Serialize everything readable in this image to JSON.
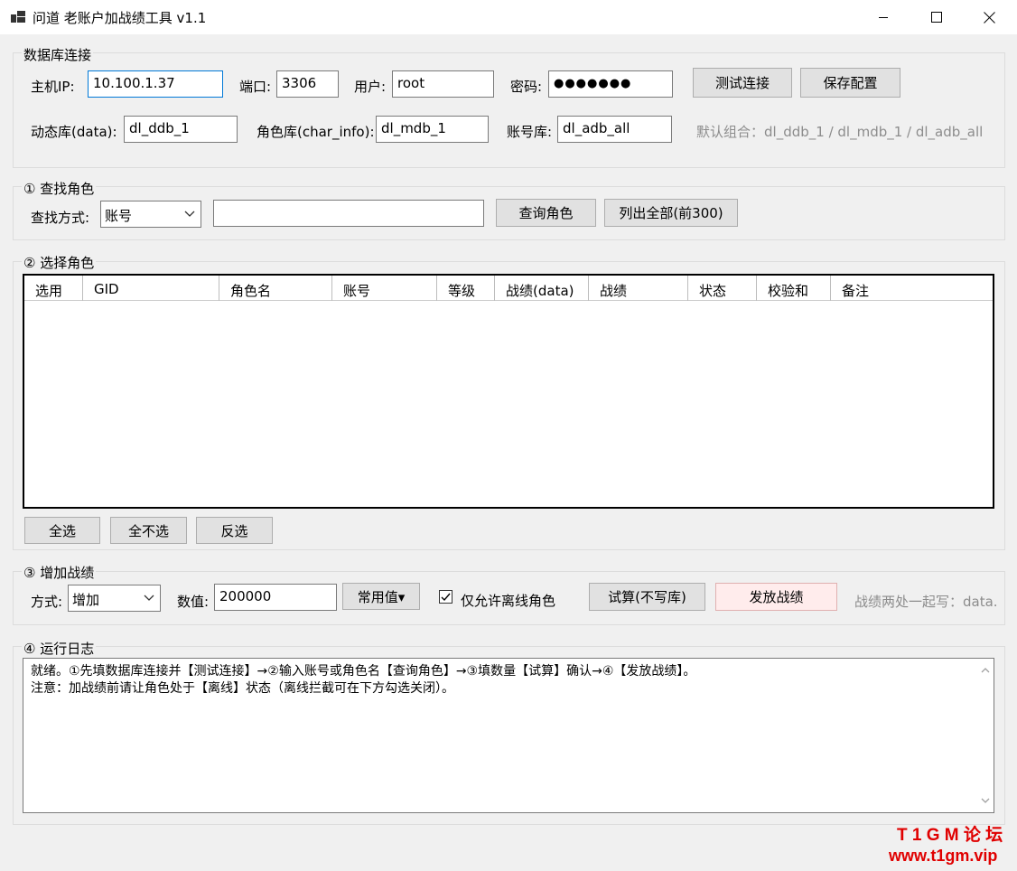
{
  "window": {
    "title": "问道 老账户加战绩工具  v1.1",
    "minimize_icon": "minimize-icon",
    "maximize_icon": "maximize-icon",
    "close_icon": "close-icon"
  },
  "db": {
    "group_title": "数据库连接",
    "host_label": "主机IP:",
    "host_value": "10.100.1.37",
    "port_label": "端口:",
    "port_value": "3306",
    "user_label": "用户:",
    "user_value": "root",
    "password_label": "密码:",
    "password_value": "●●●●●●●",
    "test_button": "测试连接",
    "save_button": "保存配置",
    "data_label": "动态库(data):",
    "data_value": "dl_ddb_1",
    "char_label": "角色库(char_info):",
    "char_value": "dl_mdb_1",
    "account_label": "账号库:",
    "account_value": "dl_adb_all",
    "default_hint": "默认组合：dl_ddb_1 / dl_mdb_1 / dl_adb_all"
  },
  "find": {
    "group_title": "① 查找角色",
    "method_label": "查找方式:",
    "method_value": "账号",
    "query_value": "",
    "query_button": "查询角色",
    "list_all_button": "列出全部(前300)"
  },
  "select": {
    "group_title": "② 选择角色",
    "columns": [
      "选用",
      "GID",
      "角色名",
      "账号",
      "等级",
      "战绩(data)",
      "战绩",
      "状态",
      "校验和",
      "备注"
    ],
    "rows": [],
    "select_all_button": "全选",
    "select_none_button": "全不选",
    "invert_button": "反选"
  },
  "add": {
    "group_title": "③ 增加战绩",
    "mode_label": "方式:",
    "mode_value": "增加",
    "amount_label": "数值:",
    "amount_value": "200000",
    "preset_button": "常用值▾",
    "offline_only_label": "仅允许离线角色",
    "offline_only_checked": true,
    "trial_button": "试算(不写库)",
    "grant_button": "发放战绩",
    "write_hint": "战绩两处一起写：data."
  },
  "log": {
    "group_title": "④ 运行日志",
    "lines": [
      "就绪。①先填数据库连接并【测试连接】→②输入账号或角色名【查询角色】→③填数量【试算】确认→④【发放战绩】。",
      "注意：加战绩前请让角色处于【离线】状态（离线拦截可在下方勾选关闭）。"
    ]
  },
  "watermark": {
    "line1": "T 1 G M 论 坛",
    "line2": "www.t1gm.vip"
  },
  "colors": {
    "window_bg": "#f0f0f0",
    "focus_border": "#0078d7",
    "grant_button_bg": "#ffecec",
    "watermark": "#e00000"
  }
}
